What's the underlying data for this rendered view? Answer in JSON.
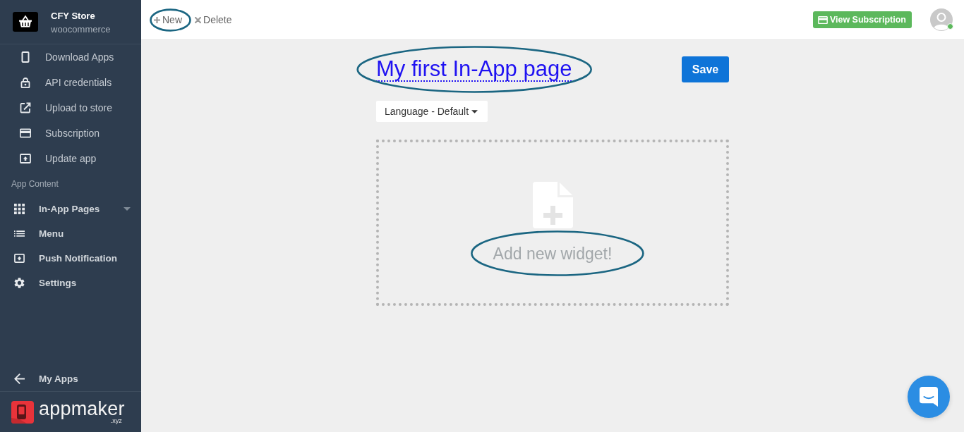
{
  "sidebar": {
    "store": {
      "name": "CFY Store",
      "platform": "woocommerce"
    },
    "app_items": [
      {
        "label": "Download Apps"
      },
      {
        "label": "API credentials"
      },
      {
        "label": "Upload to store"
      },
      {
        "label": "Subscription"
      },
      {
        "label": "Update app"
      }
    ],
    "section_title": "App Content",
    "content_items": [
      {
        "label": "In-App Pages",
        "kind": "submenu"
      },
      {
        "label": "Menu",
        "kind": "link"
      },
      {
        "label": "Push Notification",
        "kind": "link"
      },
      {
        "label": "Settings",
        "kind": "link"
      }
    ],
    "back_link": "My Apps",
    "brand": {
      "name": "appmaker",
      "suffix": ".xyz"
    }
  },
  "toolbar": {
    "actions": [
      {
        "label": "New",
        "kind": "add",
        "highlighted": true
      },
      {
        "label": "Delete",
        "kind": "delete",
        "highlighted": false
      }
    ],
    "subscription_button": "View Subscription",
    "user": {
      "online": true
    }
  },
  "editor": {
    "title": {
      "text": "My first In-App page",
      "highlighted": true
    },
    "save_button": "Save",
    "language_dropdown": "Language - Default",
    "widget_area": {
      "prompt": "Add new widget!",
      "highlighted": true
    }
  }
}
